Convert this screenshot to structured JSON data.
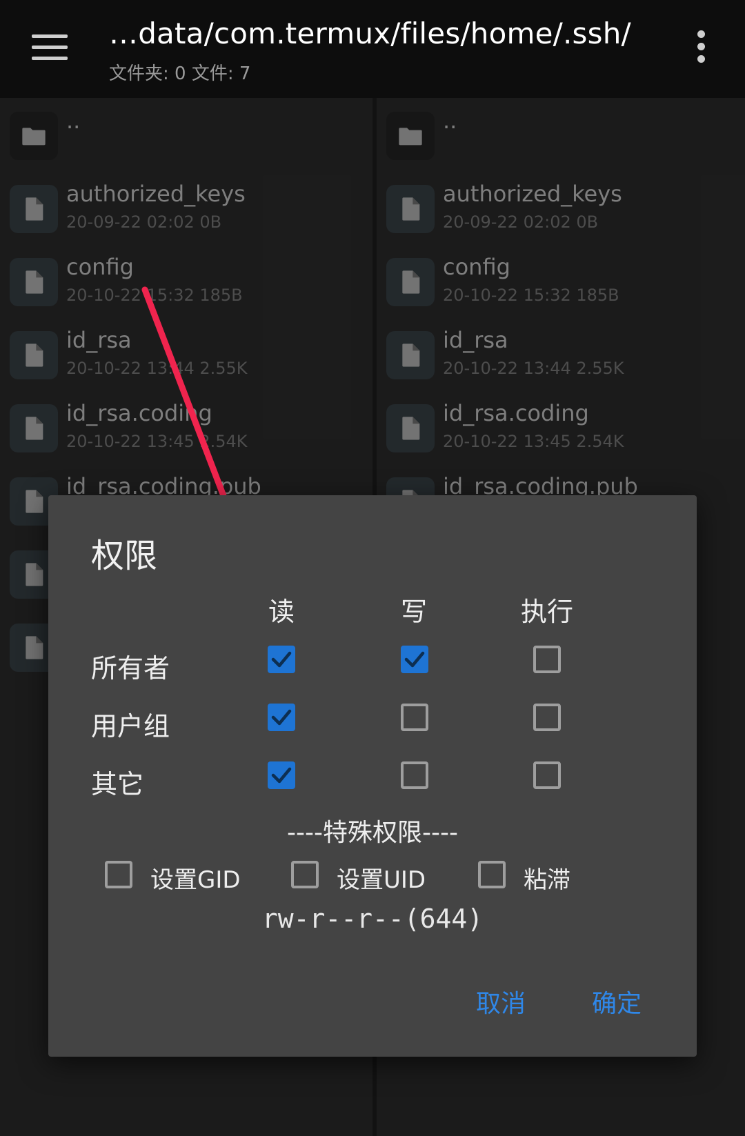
{
  "appbar": {
    "path": "…data/com.termux/files/home/.ssh/",
    "summary": "文件夹: 0  文件: 7",
    "menu_icon": "hamburger-menu-icon",
    "overflow_icon": "more-vert-icon"
  },
  "panes": [
    {
      "items": [
        {
          "name": "..",
          "meta": "",
          "icon": "folder-icon"
        },
        {
          "name": "authorized_keys",
          "meta": "20-09-22 02:02  0B",
          "icon": "file-icon"
        },
        {
          "name": "config",
          "meta": "20-10-22 15:32  185B",
          "icon": "file-icon"
        },
        {
          "name": "id_rsa",
          "meta": "20-10-22 13:44  2.55K",
          "icon": "file-icon"
        },
        {
          "name": "id_rsa.coding",
          "meta": "20-10-22 13:45  2.54K",
          "icon": "file-icon"
        },
        {
          "name": "id_rsa.coding.pub",
          "meta": "",
          "icon": "file-icon"
        },
        {
          "name": "",
          "meta": "",
          "icon": "file-icon"
        },
        {
          "name": "",
          "meta": "",
          "icon": "file-icon"
        }
      ]
    },
    {
      "items": [
        {
          "name": "..",
          "meta": "",
          "icon": "folder-icon"
        },
        {
          "name": "authorized_keys",
          "meta": "20-09-22 02:02  0B",
          "icon": "file-icon"
        },
        {
          "name": "config",
          "meta": "20-10-22 15:32  185B",
          "icon": "file-icon"
        },
        {
          "name": "id_rsa",
          "meta": "20-10-22 13:44  2.55K",
          "icon": "file-icon"
        },
        {
          "name": "id_rsa.coding",
          "meta": "20-10-22 13:45  2.54K",
          "icon": "file-icon"
        },
        {
          "name": "id_rsa.coding.pub",
          "meta": "",
          "icon": "file-icon"
        }
      ]
    }
  ],
  "annotation": {
    "color": "#f0244e"
  },
  "dialog": {
    "title": "权限",
    "columns": [
      "读",
      "写",
      "执行"
    ],
    "rows": [
      {
        "label": "所有者",
        "checks": [
          true,
          true,
          false
        ]
      },
      {
        "label": "用户组",
        "checks": [
          true,
          false,
          false
        ]
      },
      {
        "label": "其它",
        "checks": [
          true,
          false,
          false
        ]
      }
    ],
    "special_header": "----特殊权限----",
    "special_options": [
      {
        "label": "设置GID",
        "checked": false
      },
      {
        "label": "设置UID",
        "checked": false
      },
      {
        "label": "粘滞",
        "checked": false
      }
    ],
    "permission_string": "rw-r--r--(644)",
    "cancel_label": "取消",
    "ok_label": "确定",
    "accent_color": "#1e74d4"
  }
}
